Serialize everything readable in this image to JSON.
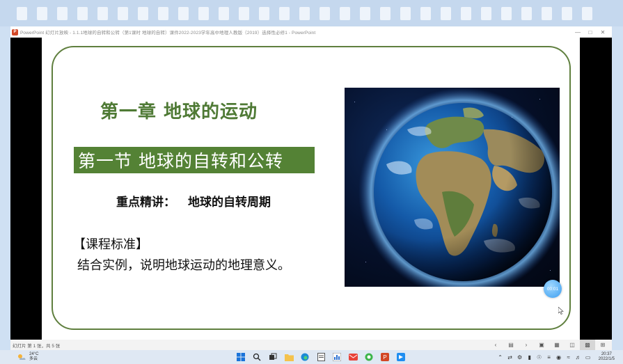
{
  "window": {
    "title": "PowerPoint 幻灯片放映  -  1.1.1地球的自转和公转（第1课时 地球的自转）课件2022-2023学年高中地理人教版（2019）选择性必修1 - PowerPoint",
    "app_icon_letter": "P"
  },
  "slide": {
    "chapter_title": "第一章 地球的运动",
    "section_title": "第一节  地球的自转和公转",
    "focus_label": "重点精讲：",
    "focus_topic": "地球的自转周期",
    "standard_heading": "【课程标准】",
    "standard_body": "结合实例，说明地球运动的地理意义。",
    "timer": "00:01"
  },
  "statusbar": {
    "text": "幻灯片 第 1 张，共 5 张"
  },
  "taskbar": {
    "weather_temp": "24°C",
    "weather_desc": "多云",
    "time": "20:37",
    "date": "2022/1/5"
  },
  "colors": {
    "frame_green": "#5f7f3e",
    "title_green": "#4f7a35",
    "banner_green": "#548235"
  }
}
